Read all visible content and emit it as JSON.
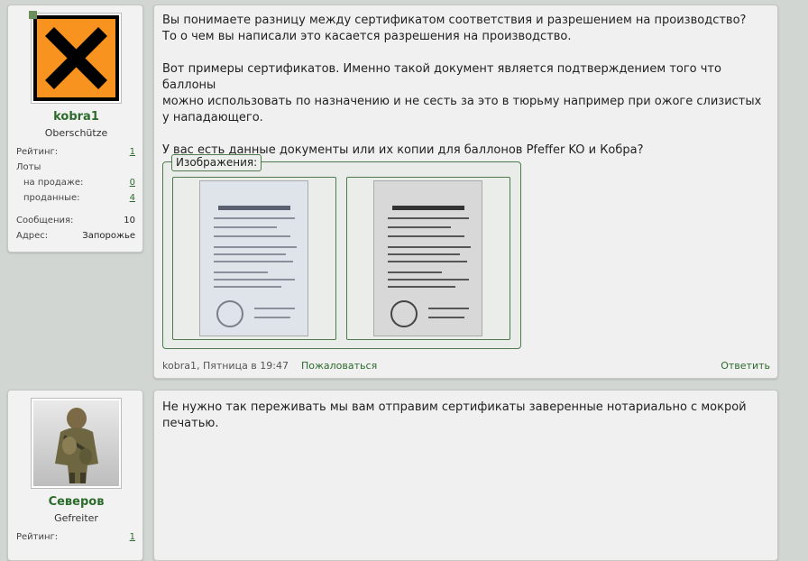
{
  "posts": [
    {
      "user": {
        "name": "kobra1",
        "rank": "Oberschütze",
        "avatar_icon": "hazard-x-icon",
        "stats": {
          "rating_label": "Рейтинг:",
          "rating": "1",
          "lots_label": "Лоты",
          "on_sale_label": "на продаже:",
          "on_sale": "0",
          "sold_label": "проданные:",
          "sold": "4",
          "messages_label": "Сообщения:",
          "messages": "10",
          "address_label": "Адрес:",
          "address": "Запорожье"
        }
      },
      "message": {
        "lines": [
          "Вы понимаете разницу между сертификатом соответствия и разрешением на производство?",
          "То о чем вы написали это касается разрешения на производство.",
          "Вот примеры сертификатов. Именно такой документ является подтверждением того что баллоны",
          "можно использовать по назначению и не сесть за это в тюрьму например при ожоге слизистых",
          "у нападающего.",
          "У вас есть данные документы или их копии для баллонов Pfeffer KO и Кобра?"
        ],
        "attachments_label": "Изображения:",
        "footer": {
          "author_time": "kobra1, Пятница в 19:47",
          "report": "Пожаловаться",
          "reply": "Ответить"
        }
      }
    },
    {
      "user": {
        "name": "Северов",
        "rank": "Gefreiter",
        "avatar_icon": "soldier-photo",
        "stats": {
          "rating_label": "Рейтинг:",
          "rating": "1"
        }
      },
      "message": {
        "lines": [
          "Не нужно так переживать мы вам отправим сертификаты заверенные нотариально с мокрой",
          "печатью."
        ]
      }
    }
  ],
  "colors": {
    "accent_green": "#2d6b2d",
    "hazard_orange": "#f7931e",
    "background": "#d2d6d2"
  }
}
